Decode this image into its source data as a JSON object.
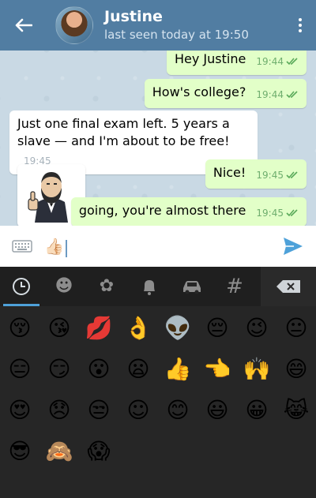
{
  "header": {
    "contact_name": "Justine",
    "status": "last seen today at 19:50",
    "back_icon": "back-arrow-icon",
    "menu_icon": "more-vert-icon"
  },
  "messages": [
    {
      "dir": "out",
      "text": "Hey Justine",
      "time": "19:44",
      "read": true
    },
    {
      "dir": "out",
      "text": "How's college?",
      "time": "19:44",
      "read": true
    },
    {
      "dir": "in",
      "text": "Just one final exam left. 5 years a slave — and I'm about to be free!",
      "time": "19:45"
    },
    {
      "dir": "out",
      "text": "Nice!",
      "time": "19:45",
      "read": true
    },
    {
      "dir": "out",
      "text": "going, you're almost there",
      "time": "19:45",
      "read": true
    }
  ],
  "input": {
    "value": "👍🏻",
    "keyboard_icon": "keyboard-icon",
    "send_icon": "send-icon"
  },
  "emoji_tabs": [
    {
      "icon": "recent-clock-icon",
      "glyph": "◷",
      "active": true
    },
    {
      "icon": "smiley-icon",
      "glyph": "☻",
      "active": false
    },
    {
      "icon": "flower-icon",
      "glyph": "✿",
      "active": false
    },
    {
      "icon": "bell-icon",
      "glyph": "🔔",
      "active": false
    },
    {
      "icon": "car-icon",
      "glyph": "🚗",
      "active": false
    },
    {
      "icon": "hash-icon",
      "glyph": "#",
      "active": false
    },
    {
      "icon": "backspace-icon",
      "glyph": "⌫",
      "active": false
    }
  ],
  "emojis": [
    "😚",
    "😘",
    "💋",
    "👌",
    "👽",
    "😔",
    "😉",
    "😐",
    "😑",
    "😏",
    "😮",
    "😦",
    "👍",
    "👈",
    "🙌",
    "😄",
    "😍",
    "😞",
    "😒",
    "☺",
    "😊",
    "😃",
    "😀",
    "😹",
    "😎",
    "🙈",
    "😱"
  ],
  "colors": {
    "header": "#517da2",
    "outgoing_bubble": "#e2ffc8",
    "incoming_bubble": "#ffffff",
    "accent": "#4ea1d9",
    "panel_bg": "#262626"
  }
}
